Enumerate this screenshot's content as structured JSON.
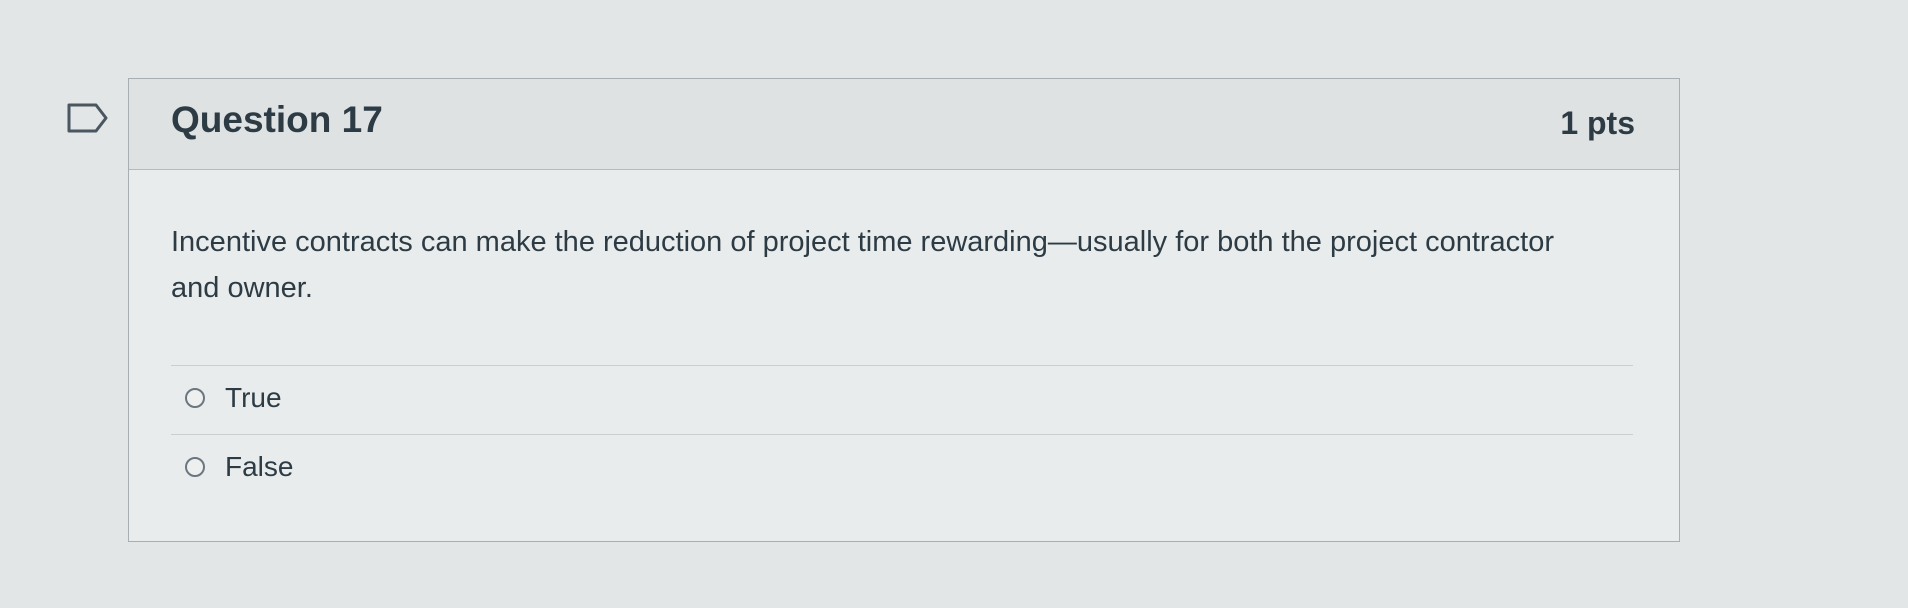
{
  "flag": {
    "icon": "bookmark-flag-icon"
  },
  "question": {
    "title": "Question 17",
    "points": "1 pts",
    "text": "Incentive contracts can make the reduction of project time rewarding—usually for both the project contractor and owner.",
    "answers": [
      {
        "label": "True",
        "selected": false
      },
      {
        "label": "False",
        "selected": false
      }
    ]
  }
}
